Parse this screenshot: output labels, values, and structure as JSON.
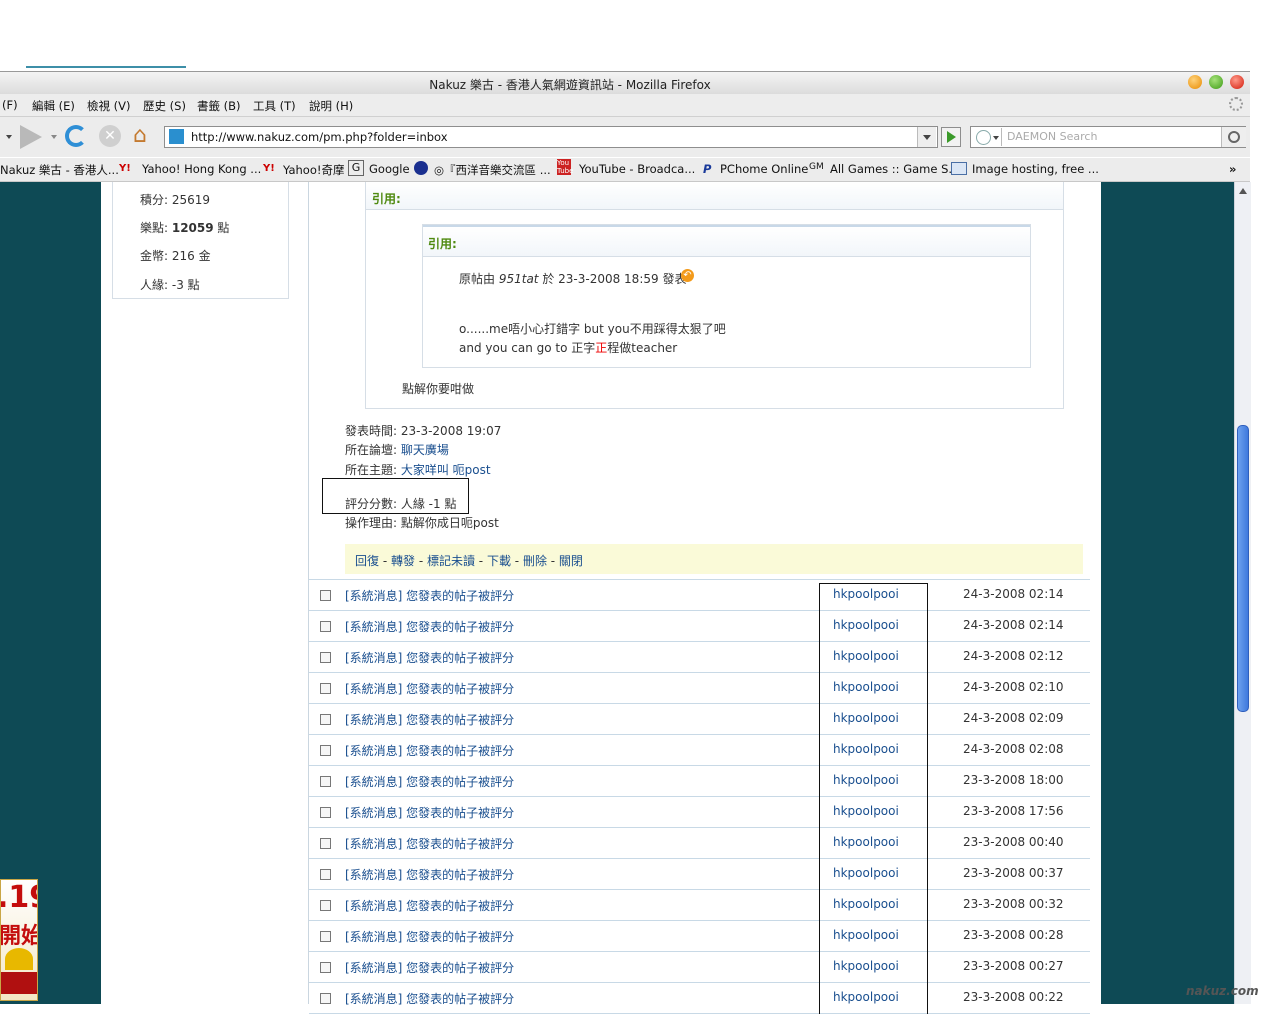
{
  "browser": {
    "title": "Nakuz 樂古 - 香港人氣網遊資訊站 - Mozilla Firefox",
    "menu": [
      "(F)",
      "編輯 (E)",
      "檢視 (V)",
      "歷史 (S)",
      "書籤 (B)",
      "工具 (T)",
      "說明 (H)"
    ],
    "url": "http://www.nakuz.com/pm.php?folder=inbox",
    "search_placeholder": "DAEMON Search",
    "bookmarks": [
      "Nakuz 樂古 - 香港人...",
      "Yahoo! Hong Kong ...",
      "Yahoo!奇摩",
      "Google",
      "◎『西洋音樂交流區 ...",
      "YouTube - Broadca...",
      "PChome Online",
      "All Games :: Game S...",
      "Image hosting, free ..."
    ],
    "overflow": "»",
    "icons": {
      "bookmark_yahoo": "Y!",
      "bookmark_google": "G",
      "bookmark_youtube": "You Tube",
      "bookmark_pchome": "P",
      "bookmark_allgames": "GM"
    }
  },
  "profile": {
    "points_label": "積分: 25619",
    "music_label": "樂點: ",
    "music_value": "12059",
    "music_unit": " 點",
    "gold_label": "金幣: 216 金",
    "popularity_label": "人緣: -3 點"
  },
  "message": {
    "quote_outer_label": "引用:",
    "quote_inner_label": "引用:",
    "inner_prefix": "原帖由 ",
    "inner_author": "951tat",
    "inner_suffix": " 於 23-3-2008 18:59 發表",
    "inner_line1": "o......me唔小心打錯字 but you不用踩得太狠了吧",
    "inner_line2_a": "and you can go to 正字",
    "inner_line2_b": "正",
    "inner_line2_c": "程做teacher",
    "outer_body": "點解你要咁做",
    "post_time": "發表時間: 23-3-2008 19:07",
    "forum_label": "所在論壇: ",
    "forum_value": "聊天廣場",
    "topic_label": "所在主題: ",
    "topic_value": "大家咩叫 呃post",
    "score_label": "評分分數: 人緣 -1 點",
    "reason_label": "操作理由: 點解你成日呃post",
    "actions": [
      "回復",
      "轉發",
      "標記未讀",
      "下載",
      "刪除",
      "關閉"
    ],
    "action_sep": " - "
  },
  "inbox": {
    "rows": [
      {
        "subject": "[系統消息] 您發表的帖子被評分",
        "from": "hkpoolpooi",
        "time": "24-3-2008 02:14"
      },
      {
        "subject": "[系統消息] 您發表的帖子被評分",
        "from": "hkpoolpooi",
        "time": "24-3-2008 02:14"
      },
      {
        "subject": "[系統消息] 您發表的帖子被評分",
        "from": "hkpoolpooi",
        "time": "24-3-2008 02:12"
      },
      {
        "subject": "[系統消息] 您發表的帖子被評分",
        "from": "hkpoolpooi",
        "time": "24-3-2008 02:10"
      },
      {
        "subject": "[系統消息] 您發表的帖子被評分",
        "from": "hkpoolpooi",
        "time": "24-3-2008 02:09"
      },
      {
        "subject": "[系統消息] 您發表的帖子被評分",
        "from": "hkpoolpooi",
        "time": "24-3-2008 02:08"
      },
      {
        "subject": "[系統消息] 您發表的帖子被評分",
        "from": "hkpoolpooi",
        "time": "23-3-2008 18:00"
      },
      {
        "subject": "[系統消息] 您發表的帖子被評分",
        "from": "hkpoolpooi",
        "time": "23-3-2008 17:56"
      },
      {
        "subject": "[系統消息] 您發表的帖子被評分",
        "from": "hkpoolpooi",
        "time": "23-3-2008 00:40"
      },
      {
        "subject": "[系統消息] 您發表的帖子被評分",
        "from": "hkpoolpooi",
        "time": "23-3-2008 00:37"
      },
      {
        "subject": "[系統消息] 您發表的帖子被評分",
        "from": "hkpoolpooi",
        "time": "23-3-2008 00:32"
      },
      {
        "subject": "[系統消息] 您發表的帖子被評分",
        "from": "hkpoolpooi",
        "time": "23-3-2008 00:28"
      },
      {
        "subject": "[系統消息] 您發表的帖子被評分",
        "from": "hkpoolpooi",
        "time": "23-3-2008 00:27"
      },
      {
        "subject": "[系統消息] 您發表的帖子被評分",
        "from": "hkpoolpooi",
        "time": "23-3-2008 00:22"
      }
    ]
  },
  "ad": {
    "line1": ".19",
    "line2": "開始"
  },
  "watermark": "nakuz.com"
}
